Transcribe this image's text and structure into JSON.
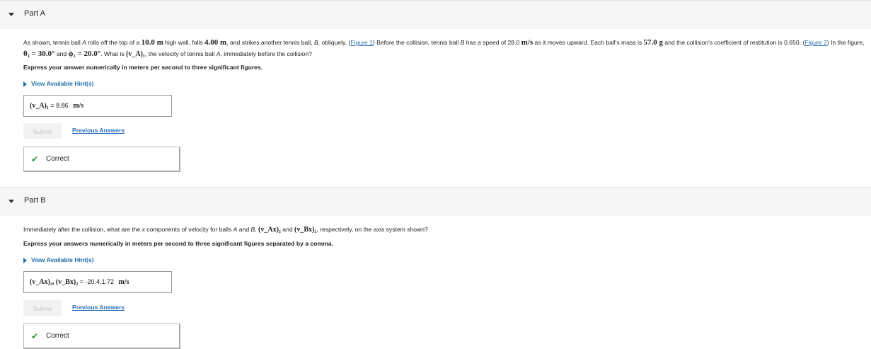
{
  "partA": {
    "title": "Part A",
    "q": {
      "t1": "As shown, tennis ball ",
      "t1b": "A",
      "t2": " rolls off the top of a ",
      "m_h": "10.0 m",
      "t3": " high wall, falls ",
      "m_f": "4.00 m",
      "t4": ", and strikes another tennis ball, ",
      "t4b": "B",
      "t5": ", obliquely. (",
      "fig1": "Figure 1",
      "t6": ") Before the collision, tennis ball ",
      "t6b": "B",
      "t7": " has a speed of 28.0 ",
      "m_ms": "m/s",
      "t8": " as it moves upward. Each ball's mass is ",
      "m_g": "57.0 g",
      "t9": " and the collision's coefficient of restitution is 0.650. (",
      "fig2": "Figure 2",
      "t10": ") In the figure, ",
      "theta": "θ₁ = 30.0°",
      "t11": " and ",
      "phi": "ϕ₁ = 20.0°",
      "t12": ". What is ",
      "va": "(v_A)₁",
      "t13": ", the velocity of tennis ball ",
      "t13b": "A",
      "t14": ", immediately before the collision?"
    },
    "instructions": "Express your answer numerically in meters per second to three significant figures.",
    "hint_label": "View Available Hint(s)",
    "answer_label": "(v_A)₁",
    "answer_value": "= 8.86",
    "answer_unit": "m/s",
    "submit_label": "Submit",
    "previous_answers_label": "Previous Answers",
    "result_label": "Correct"
  },
  "partB": {
    "title": "Part B",
    "q": {
      "t1": "Immediately after the collision, what are the ",
      "t1i": "x",
      "t2": " components of velocity for balls ",
      "t2a": "A",
      "t3": " and ",
      "t3b": "B",
      "t4": ", ",
      "vax": "(v_Ax)₂",
      "t5": " and ",
      "vbx": "(v_Bx)₂",
      "t6": ", respectively, on the axis system shown?"
    },
    "instructions": "Express your answers numerically in meters per second to three significant figures separated by a comma.",
    "hint_label": "View Available Hint(s)",
    "answer_label": "(v_Ax)₂, (v_Bx)₂",
    "answer_value": "= -20.4,1.72",
    "answer_unit": "m/s",
    "submit_label": "Submit",
    "previous_answers_label": "Previous Answers",
    "result_label": "Correct"
  },
  "colors": {
    "link": "#2a6ebb",
    "hint": "#1f6fa8",
    "check": "#2e8b3a",
    "header_bg": "#f6f6f6"
  },
  "icons": {
    "collapse": "caret-down-icon",
    "hint": "caret-right-icon",
    "correct": "checkmark-icon"
  }
}
